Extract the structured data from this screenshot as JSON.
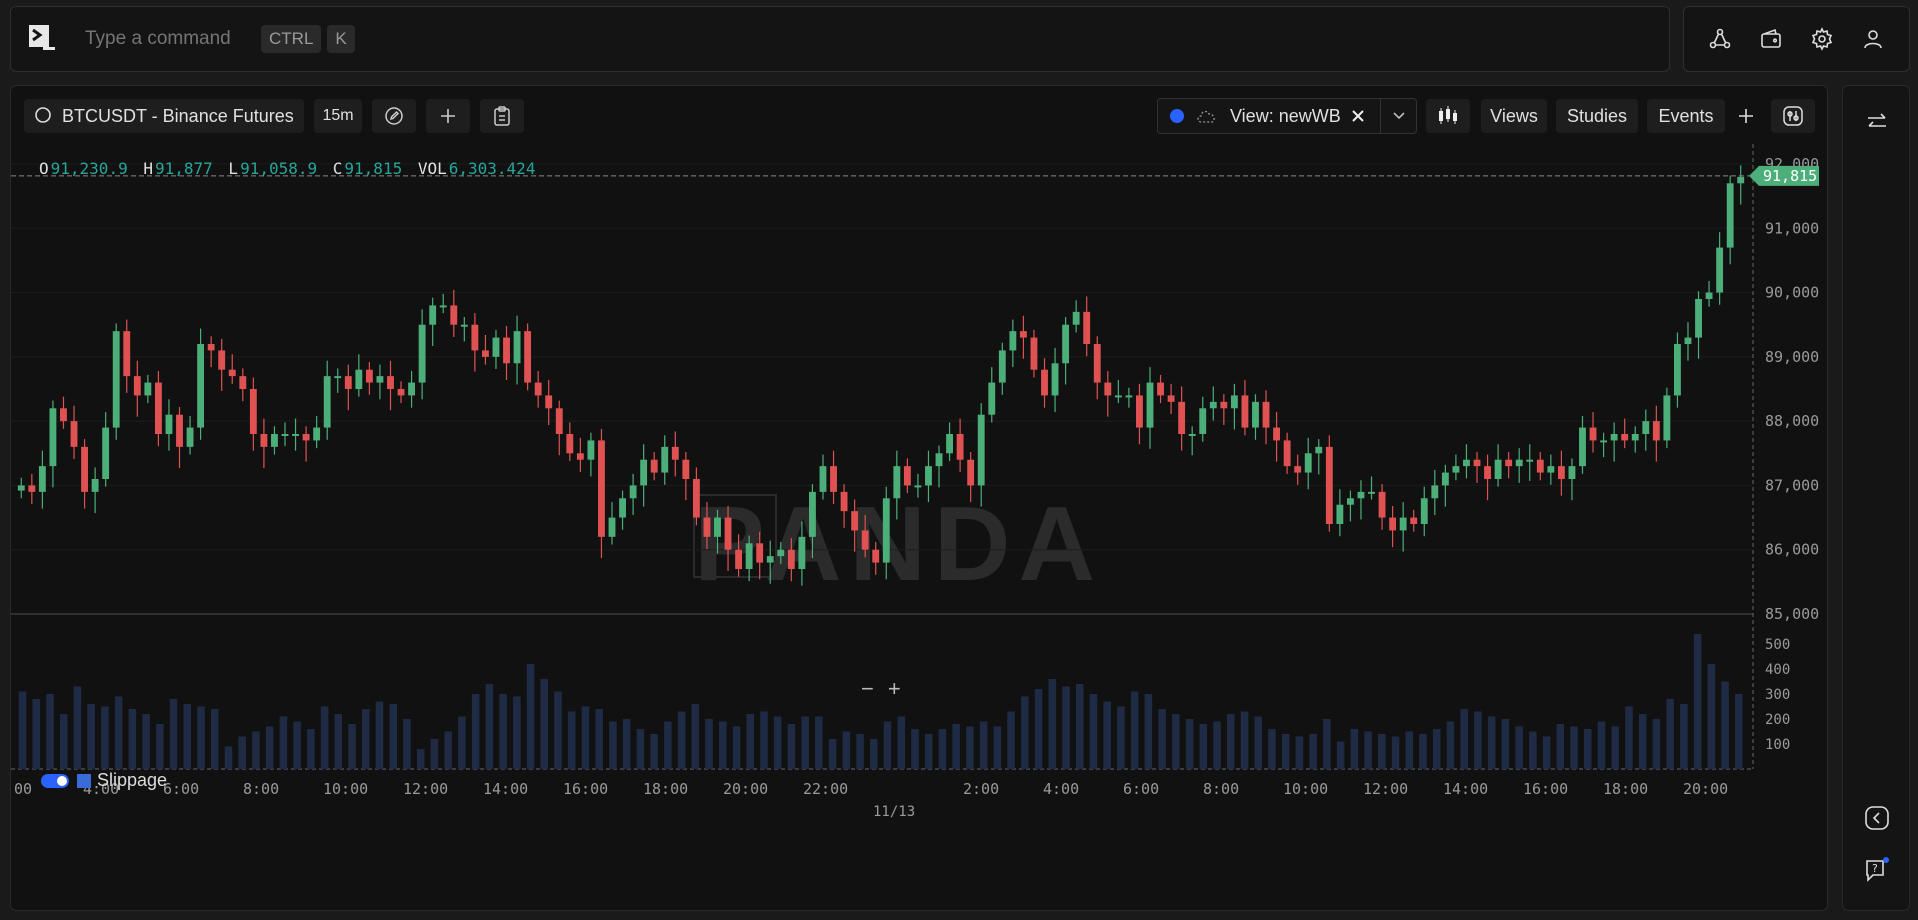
{
  "command_bar": {
    "placeholder": "Type a command",
    "shortcut_keys": [
      "CTRL",
      "K"
    ]
  },
  "top_icons": [
    "share-network-icon",
    "wallet-icon",
    "gear-icon",
    "user-icon"
  ],
  "toolbar": {
    "symbol": "BTCUSDT - Binance Futures",
    "timeframe": "15m",
    "view_label": "View: newWB",
    "views_label": "Views",
    "studies_label": "Studies",
    "events_label": "Events"
  },
  "ohlc": {
    "o_label": "O",
    "o": "91,230.9",
    "h_label": "H",
    "h": "91,877",
    "l_label": "L",
    "l": "91,058.9",
    "c_label": "C",
    "c": "91,815",
    "vol_label": "VOL",
    "vol": "6,303.424"
  },
  "watermark": "PANDA",
  "last_price_label": "91,815",
  "volume_legend": "Slippage",
  "colors": {
    "up": "#4caf7a",
    "down": "#e05252",
    "volume": "#1f2a44",
    "accent": "#2962ff"
  },
  "chart_data": {
    "type": "candlestick",
    "price_axis": {
      "min": 85000,
      "max": 92000,
      "ticks": [
        "92,000",
        "91,000",
        "90,000",
        "89,000",
        "88,000",
        "87,000",
        "86,000",
        "85,000"
      ]
    },
    "volume_axis": {
      "ticks": [
        "500",
        "400",
        "300",
        "200",
        "100"
      ],
      "max": 580
    },
    "time_ticks": [
      ":00",
      "4:00",
      "6:00",
      "8:00",
      "10:00",
      "12:00",
      "14:00",
      "16:00",
      "18:00",
      "20:00",
      "22:00",
      "2:00",
      "4:00",
      "6:00",
      "8:00",
      "10:00",
      "12:00",
      "14:00",
      "16:00",
      "18:00",
      "20:00"
    ],
    "date_label": "11/13",
    "last_price": 91815,
    "closes": [
      87000,
      86900,
      87300,
      88200,
      88000,
      87600,
      86900,
      87100,
      87900,
      89400,
      88700,
      88400,
      88600,
      87800,
      88100,
      87600,
      87900,
      89200,
      89100,
      88800,
      88700,
      88500,
      87800,
      87600,
      87800,
      87800,
      87800,
      87700,
      87900,
      88700,
      88700,
      88500,
      88800,
      88600,
      88700,
      88500,
      88400,
      88600,
      89500,
      89800,
      89800,
      89500,
      89500,
      89100,
      89000,
      89300,
      88900,
      89400,
      88600,
      88400,
      88200,
      87800,
      87500,
      87400,
      87700,
      86200,
      86500,
      86800,
      87000,
      87400,
      87200,
      87600,
      87400,
      87100,
      86500,
      86200,
      86500,
      86000,
      85700,
      86100,
      85800,
      85900,
      86000,
      85700,
      86200,
      86900,
      87300,
      86900,
      86600,
      86300,
      86000,
      85800,
      86800,
      87300,
      87000,
      87000,
      87300,
      87500,
      87800,
      87400,
      87000,
      88100,
      88600,
      89100,
      89400,
      89300,
      88800,
      88400,
      88900,
      89500,
      89700,
      89200,
      88600,
      88400,
      88400,
      88400,
      87900,
      88600,
      88400,
      88300,
      87800,
      87800,
      88200,
      88300,
      88200,
      88400,
      87900,
      88300,
      87900,
      87700,
      87300,
      87200,
      87500,
      87600,
      86400,
      86700,
      86800,
      86900,
      86900,
      86500,
      86300,
      86500,
      86400,
      86800,
      87000,
      87200,
      87300,
      87400,
      87300,
      87100,
      87400,
      87300,
      87400,
      87400,
      87200,
      87300,
      87100,
      87300,
      87900,
      87700,
      87700,
      87800,
      87700,
      87800,
      88000,
      87700,
      88400,
      89200,
      89300,
      89900,
      90000,
      90700,
      91700,
      91800
    ],
    "volumes": [
      310,
      280,
      300,
      220,
      330,
      260,
      250,
      290,
      240,
      220,
      180,
      280,
      260,
      250,
      240,
      90,
      130,
      150,
      170,
      210,
      190,
      160,
      250,
      220,
      180,
      240,
      270,
      260,
      200,
      80,
      120,
      150,
      210,
      300,
      340,
      300,
      290,
      420,
      360,
      310,
      230,
      250,
      240,
      190,
      200,
      160,
      140,
      190,
      230,
      260,
      200,
      190,
      170,
      220,
      230,
      210,
      180,
      210,
      210,
      120,
      150,
      140,
      120,
      190,
      210,
      160,
      140,
      160,
      180,
      170,
      190,
      170,
      230,
      290,
      320,
      360,
      330,
      340,
      300,
      270,
      250,
      310,
      300,
      240,
      220,
      200,
      180,
      190,
      220,
      230,
      210,
      160,
      140,
      130,
      140,
      200,
      110,
      160,
      150,
      140,
      130,
      150,
      140,
      160,
      190,
      240,
      230,
      210,
      200,
      170,
      150,
      130,
      180,
      170,
      160,
      190,
      170,
      250,
      220,
      200,
      280,
      260,
      540,
      420,
      350,
      300
    ]
  }
}
